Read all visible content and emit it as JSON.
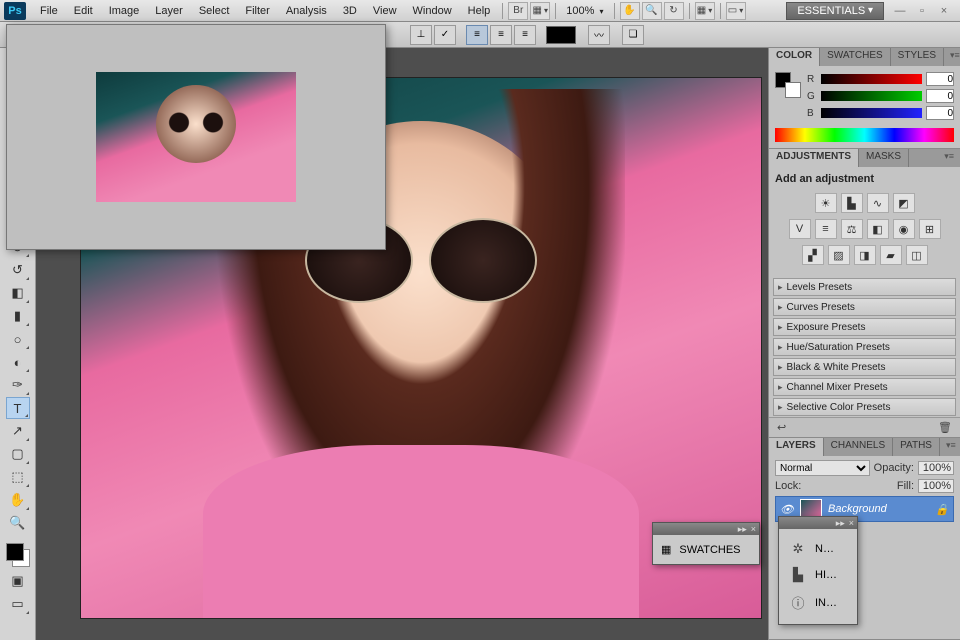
{
  "menu": {
    "items": [
      "File",
      "Edit",
      "Image",
      "Layer",
      "Select",
      "Filter",
      "Analysis",
      "3D",
      "View",
      "Window",
      "Help"
    ],
    "zoom": "100%",
    "workspace": "ESSENTIALS"
  },
  "optbar": {
    "check": "✓"
  },
  "color": {
    "tabs": [
      "COLOR",
      "SWATCHES",
      "STYLES"
    ],
    "r": "0",
    "g": "0",
    "b": "0"
  },
  "adjust": {
    "tabs": [
      "ADJUSTMENTS",
      "MASKS"
    ],
    "title": "Add an adjustment",
    "presets": [
      "Levels Presets",
      "Curves Presets",
      "Exposure Presets",
      "Hue/Saturation Presets",
      "Black & White Presets",
      "Channel Mixer Presets",
      "Selective Color Presets"
    ]
  },
  "layers": {
    "tabs": [
      "LAYERS",
      "CHANNELS",
      "PATHS"
    ],
    "mode": "Normal",
    "opacity_l": "Opacity:",
    "opacity": "100%",
    "lock_l": "Lock:",
    "fill_l": "Fill:",
    "fill": "100%",
    "bg": "Background"
  },
  "float_sw": {
    "label": "SWATCHES"
  },
  "float_menu": {
    "items": [
      "N…",
      "HI…",
      "IN…"
    ]
  }
}
